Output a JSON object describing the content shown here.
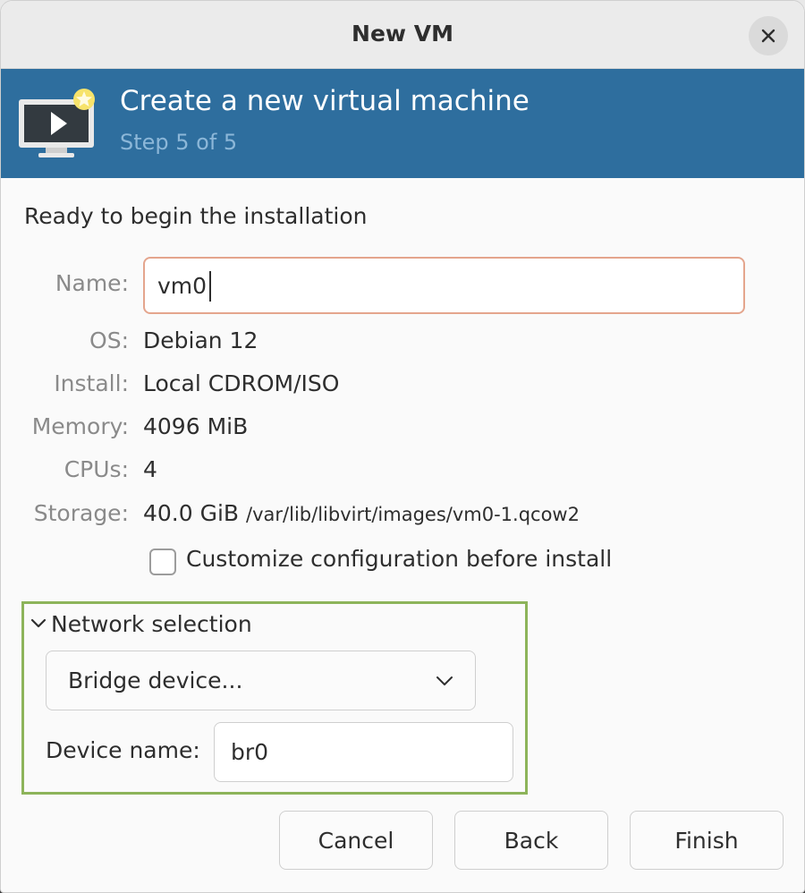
{
  "window": {
    "title": "New VM"
  },
  "banner": {
    "title": "Create a new virtual machine",
    "step": "Step 5 of 5",
    "icon": "monitor-play-icon",
    "color": "#2e6e9e"
  },
  "summary": {
    "heading": "Ready to begin the installation",
    "name_label": "Name:",
    "name_value": "vm0",
    "os_label": "OS:",
    "os_value": "Debian 12",
    "install_label": "Install:",
    "install_value": "Local CDROM/ISO",
    "memory_label": "Memory:",
    "memory_value": "4096 MiB",
    "cpus_label": "CPUs:",
    "cpus_value": "4",
    "storage_label": "Storage:",
    "storage_size": "40.0 GiB",
    "storage_path": "/var/lib/libvirt/images/vm0-1.qcow2"
  },
  "customize": {
    "label": "Customize configuration before install",
    "checked": false
  },
  "network": {
    "header": "Network selection",
    "expanded": true,
    "selected": "Bridge device...",
    "device_label": "Device name:",
    "device_value": "br0",
    "highlight_color": "#8db45a"
  },
  "buttons": {
    "cancel": "Cancel",
    "back": "Back",
    "finish": "Finish"
  }
}
